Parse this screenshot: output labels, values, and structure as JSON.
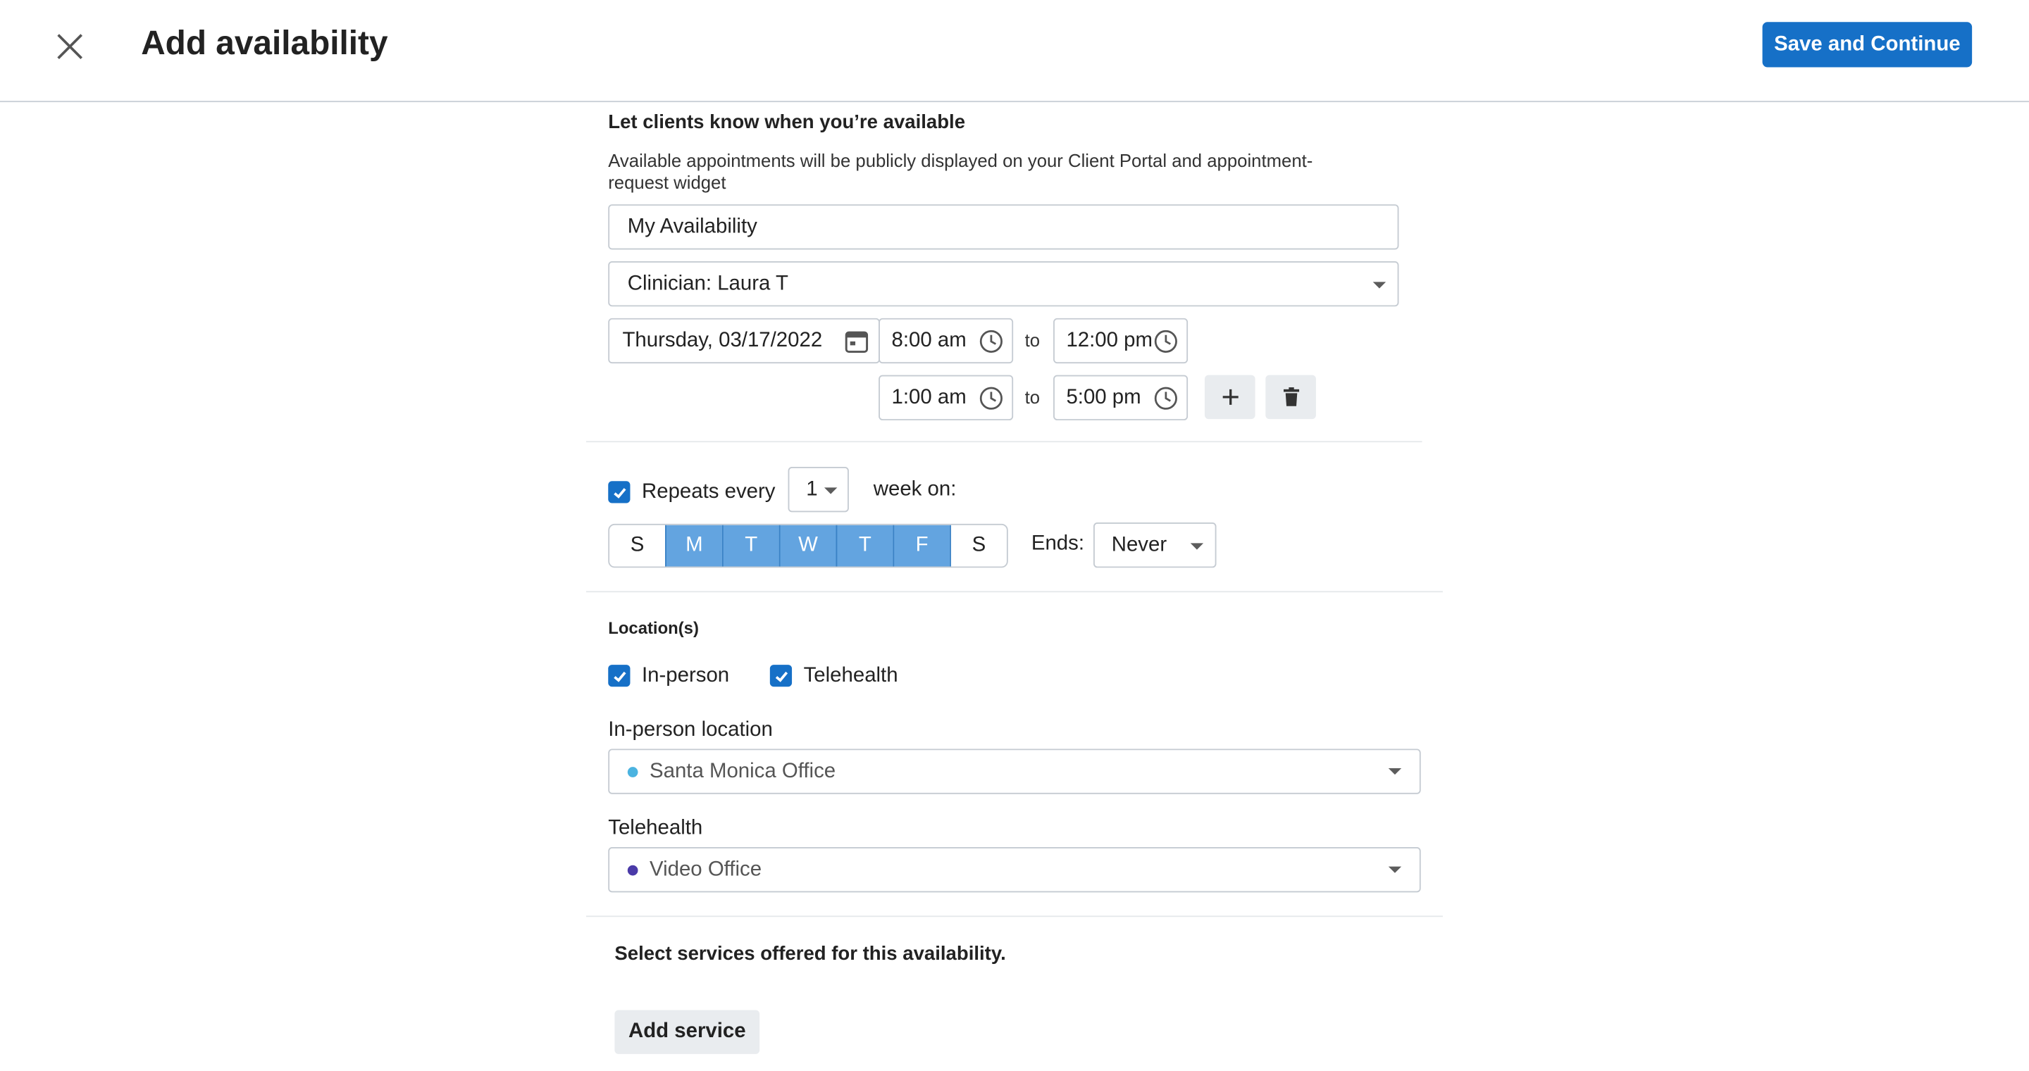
{
  "header": {
    "title": "Add availability",
    "save_label": "Save and Continue"
  },
  "intro": {
    "heading": "Let clients know when you’re available",
    "description_line1": "Available appointments will be publicly displayed on your Client Portal and appointment-",
    "description_line2": "request widget"
  },
  "form": {
    "name_value": "My Availability",
    "clinician_value": "Clinician: Laura T",
    "date_value": "Thursday, 03/17/2022",
    "to_label": "to",
    "slots": [
      {
        "start": "8:00 am",
        "end": "12:00 pm"
      },
      {
        "start": "1:00 am",
        "end": "5:00 pm"
      }
    ]
  },
  "repeat": {
    "checked": true,
    "label": "Repeats every",
    "interval_value": "1",
    "unit_label": "week on:",
    "days": [
      {
        "label": "S",
        "selected": false
      },
      {
        "label": "M",
        "selected": true
      },
      {
        "label": "T",
        "selected": true
      },
      {
        "label": "W",
        "selected": true
      },
      {
        "label": "T",
        "selected": true
      },
      {
        "label": "F",
        "selected": true
      },
      {
        "label": "S",
        "selected": false
      }
    ],
    "ends_label": "Ends:",
    "ends_value": "Never"
  },
  "locations": {
    "heading": "Location(s)",
    "in_person_label": "In-person",
    "in_person_checked": true,
    "telehealth_label": "Telehealth",
    "telehealth_checked": true,
    "in_person_location_label": "In-person location",
    "in_person_location_value": "Santa Monica Office",
    "in_person_dot_color": "#4bb3e0",
    "telehealth_field_label": "Telehealth",
    "telehealth_value": "Video Office",
    "telehealth_dot_color": "#4a3aa8"
  },
  "services": {
    "heading": "Select services offered for this availability.",
    "add_label": "Add service"
  },
  "colors": {
    "accent": "#1670c7",
    "day_selected": "#63a4e0"
  }
}
